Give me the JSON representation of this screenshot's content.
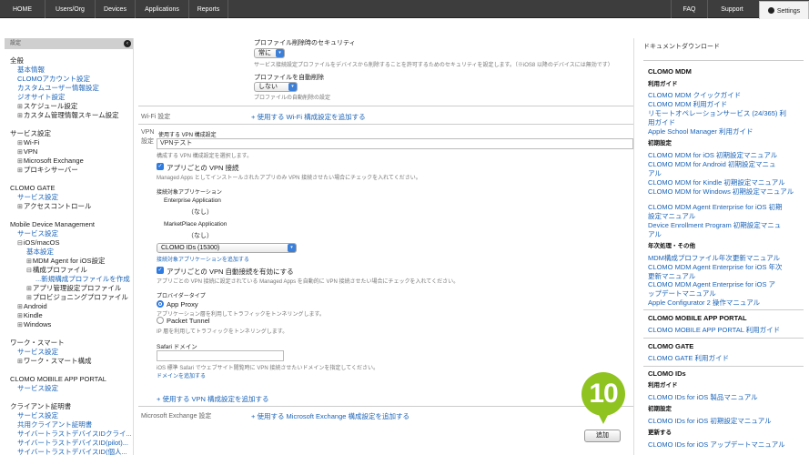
{
  "nav": {
    "home": "HOME",
    "users_org": "Users/Org",
    "devices": "Devices",
    "applications": "Applications",
    "reports": "Reports",
    "faq": "FAQ",
    "support": "Support",
    "settings": "Settings"
  },
  "sidebar": {
    "header": "設定",
    "items": [
      "全般",
      "基本情報",
      "CLOMOアカウント設定",
      "カスタムユーザー情報設定",
      "ジオサイト設定",
      "スケジュール設定",
      "カスタム管理情報スキーム設定",
      "サービス設定",
      "Wi-Fi",
      "VPN",
      "Microsoft Exchange",
      "プロキシサーバー",
      "CLOMO GATE",
      "サービス設定",
      "アクセスコントロール",
      "Mobile Device Management",
      "サービス設定",
      "iOS/macOS",
      "基本設定",
      "MDM Agent for iOS設定",
      "構成プロファイル",
      "...新規構成プロファイルを作成",
      "アプリ管理設定プロファイル",
      "プロビジョニングプロファイル",
      "Android",
      "Kindle",
      "Windows",
      "ワーク・スマート",
      "サービス設定",
      "ワーク・スマート構成",
      "CLOMO MOBILE APP PORTAL",
      "サービス設定",
      "クライアント証明書",
      "サービス設定",
      "共用クライアント証明書",
      "サイバートラストデバイスIDクライ...",
      "サイバートラストデバイスID(pilot)...",
      "サイバートラストデバイスID(個人..."
    ]
  },
  "main": {
    "remove_security_label": "プロファイル削除時のセキュリティ",
    "remove_security_value": "常に",
    "remove_security_help": "サービス接続設定プロファイルをデバイスから削除することを許可するためのセキュリティを設定します。（※iOS8 以降のデバイスには無効です）",
    "auto_remove_label": "プロファイルを自動削除",
    "auto_remove_value": "しない",
    "auto_remove_help": "プロファイルの自動削除の設定",
    "wifi_section": "Wi-Fi 設定",
    "wifi_add": "+ 使用する Wi-Fi 構成設定を追加する",
    "vpn_section": "VPN 設定",
    "vpn_config_label": "使用する VPN 構成設定",
    "vpn_config_value": "VPNテスト",
    "vpn_config_help": "構成する VPN 構成設定を選択します。",
    "per_app_vpn_label": "アプリごとの VPN 接続",
    "per_app_vpn_help": "Managed Apps としてインストールされたアプリのみ VPN 接続させたい場合にチェックを入れてください。",
    "target_apps_label": "接続対象アプリケーション",
    "enterprise_app_label": "Enterprise Application",
    "enterprise_app_value": "（なし）",
    "marketplace_app_label": "MarketPlace Application",
    "marketplace_app_value": "（なし）",
    "clomo_ids_value": "CLOMO IDs (15300)",
    "add_target_app": "接続対象アプリケーションを追加する",
    "auto_connect_label": "アプリごとの VPN 自動接続を有効にする",
    "auto_connect_help": "アプリごとの VPN 接続に設定されている Managed Apps を自動的に VPN 接続させたい場合にチェックを入れてください。",
    "provider_type_label": "プロバイダータイプ",
    "app_proxy_label": "App Proxy",
    "app_proxy_help": "アプリケーション層を利用してトラフィックをトンネリングします。",
    "packet_tunnel_label": "Packet Tunnel",
    "packet_tunnel_help": "IP 層を利用してトラフィックをトンネリングします。",
    "safari_domain_label": "Safari ドメイン",
    "safari_domain_help": "iOS 標準 Safari でウェブサイト閲覧時に VPN 接続させたいドメインを指定してください。",
    "add_domain": "ドメインを追加する",
    "vpn_add": "+ 使用する VPN 構成設定を追加する",
    "exchange_section": "Microsoft Exchange 設定",
    "exchange_add": "+ 使用する Microsoft Exchange 構成設定を追加する",
    "add_button": "追加",
    "step_badge": "10"
  },
  "right_panel": {
    "title": "ドキュメントダウンロード",
    "items": [
      "CLOMO MDM",
      "利用ガイド",
      "CLOMO MDM クイックガイド",
      "CLOMO MDM 利用ガイド",
      "リモートオペレーションサービス (24/365) 利",
      "用ガイド",
      "Apple School Manager 利用ガイド",
      "初期設定",
      "CLOMO MDM for iOS 初期設定マニュアル",
      "CLOMO MDM for Android 初期設定マニュ",
      "アル",
      "CLOMO MDM for Kindle 初期設定マニュアル",
      "CLOMO MDM for Windows 初期設定マニュアル",
      "CLOMO MDM Agent Enterprise for iOS 初期",
      "設定マニュアル",
      "Device Enrollment Program 初期設定マニュ",
      "アル",
      "年次処理・その他",
      "MDM構成プロファイル年次更新マニュアル",
      "CLOMO MDM Agent Enterprise for iOS 年次",
      "更新マニュアル",
      "CLOMO MDM Agent Enterprise for iOS ア",
      "ップデートマニュアル",
      "Apple Configurator 2 操作マニュアル",
      "CLOMO MOBILE APP PORTAL",
      "CLOMO MOBILE APP PORTAL 利用ガイド",
      "CLOMO GATE",
      "CLOMO GATE 利用ガイド",
      "CLOMO IDs",
      "利用ガイド",
      "CLOMO IDs for iOS 製品マニュアル",
      "初期設定",
      "CLOMO IDs for iOS 初期設定マニュアル",
      "更新する",
      "CLOMO IDs for iOS アップデートマニュアル"
    ]
  },
  "colors": {
    "accent": "#8fc31f",
    "link": "#1a63b8",
    "nav_bg": "#3d3d3d"
  }
}
